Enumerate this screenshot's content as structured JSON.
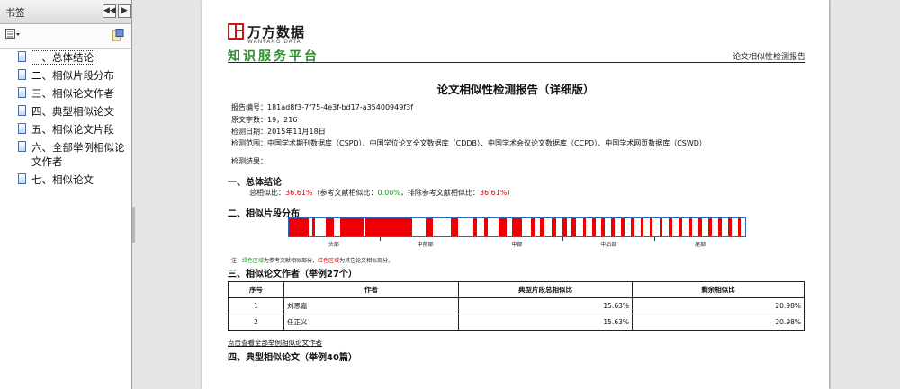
{
  "bookmarks_panel": {
    "title": "书签",
    "collapse_glyph": "◀◀",
    "close_glyph": "▶",
    "options_icon": "options-menu-icon",
    "expand_icon": "expand-bookmark-icon",
    "items": [
      {
        "label": "一、总体结论"
      },
      {
        "label": "二、相似片段分布"
      },
      {
        "label": "三、相似论文作者"
      },
      {
        "label": "四、典型相似论文"
      },
      {
        "label": "五、相似论文片段"
      },
      {
        "label": "六、全部举例相似论文作者"
      },
      {
        "label": "七、相似论文"
      }
    ]
  },
  "page": {
    "logo_text": "万方数据",
    "logo_english": "WANFANG DATA",
    "logo_tagline": "知识服务平台",
    "header_right": "论文相似性检测报告",
    "report_title": "论文相似性检测报告（详细版）",
    "meta": {
      "report_no": "报告编号：181ad8f3-7f75-4e3f-bd17-a35400949f3f",
      "char_count": "原文字数：19，216",
      "check_date": "检测日期：2015年11月18日",
      "scope": "检测范围：中国学术期刊数据库（CSPD）、中国学位论文全文数据库（CDDB）、中国学术会议论文数据库（CCPD）、中国学术网页数据库（CSWD）",
      "result_label": "检测结果："
    },
    "section1": {
      "title": "一、总体结论",
      "total_label": "总相似比：",
      "total_value": "36.61%",
      "ref_label": "（参考文献相似比：",
      "ref_value": "0.00%",
      "excl_label": "，排除参考文献相似比：",
      "excl_value": "36.61%",
      "close": "）"
    },
    "section2": {
      "title": "二、相似片段分布",
      "bar_border_color": "#2d63b8",
      "segment_color": "#ee0000",
      "segments": [
        {
          "start": 0.0,
          "end": 0.044
        },
        {
          "start": 0.051,
          "end": 0.058
        },
        {
          "start": 0.081,
          "end": 0.098
        },
        {
          "start": 0.112,
          "end": 0.163
        },
        {
          "start": 0.167,
          "end": 0.27
        },
        {
          "start": 0.3,
          "end": 0.315
        },
        {
          "start": 0.355,
          "end": 0.37
        },
        {
          "start": 0.405,
          "end": 0.412
        },
        {
          "start": 0.428,
          "end": 0.435
        },
        {
          "start": 0.46,
          "end": 0.478
        },
        {
          "start": 0.49,
          "end": 0.51
        },
        {
          "start": 0.53,
          "end": 0.54
        },
        {
          "start": 0.55,
          "end": 0.56
        },
        {
          "start": 0.575,
          "end": 0.585
        },
        {
          "start": 0.6,
          "end": 0.61
        },
        {
          "start": 0.62,
          "end": 0.63
        },
        {
          "start": 0.644,
          "end": 0.651
        },
        {
          "start": 0.665,
          "end": 0.672
        },
        {
          "start": 0.685,
          "end": 0.692
        },
        {
          "start": 0.707,
          "end": 0.714
        },
        {
          "start": 0.728,
          "end": 0.735
        },
        {
          "start": 0.75,
          "end": 0.757
        },
        {
          "start": 0.771,
          "end": 0.778
        },
        {
          "start": 0.79,
          "end": 0.797
        },
        {
          "start": 0.812,
          "end": 0.818
        },
        {
          "start": 0.833,
          "end": 0.84
        },
        {
          "start": 0.855,
          "end": 0.862
        },
        {
          "start": 0.877,
          "end": 0.884
        },
        {
          "start": 0.898,
          "end": 0.905
        },
        {
          "start": 0.92,
          "end": 0.927
        },
        {
          "start": 0.941,
          "end": 0.948
        },
        {
          "start": 0.963,
          "end": 0.97
        },
        {
          "start": 0.984,
          "end": 0.991
        }
      ],
      "axis_labels": [
        {
          "label": "头部",
          "pos": 0.1
        },
        {
          "label": "中前部",
          "pos": 0.3
        },
        {
          "label": "中部",
          "pos": 0.5
        },
        {
          "label": "中后部",
          "pos": 0.7
        },
        {
          "label": "尾部",
          "pos": 0.9
        }
      ],
      "note_prefix": "注：",
      "note_green": "绿色区域",
      "note_mid": "为参考文献相似部分，",
      "note_red": "红色区域",
      "note_end": "为其它论文相似部分。"
    },
    "section3": {
      "title": "三、相似论文作者（举例27个）",
      "headers": [
        "序号",
        "作者",
        "典型片段总相似比",
        "剩余相似比"
      ],
      "rows": [
        {
          "no": "1",
          "author": "刘思嘉",
          "typical": "15.63%",
          "remaining": "20.98%"
        },
        {
          "no": "2",
          "author": "任正义",
          "typical": "15.63%",
          "remaining": "20.98%"
        }
      ],
      "more_link": "点击查看全部举例相似论文作者"
    },
    "section4": {
      "title": "四、典型相似论文（举例40篇）"
    }
  }
}
